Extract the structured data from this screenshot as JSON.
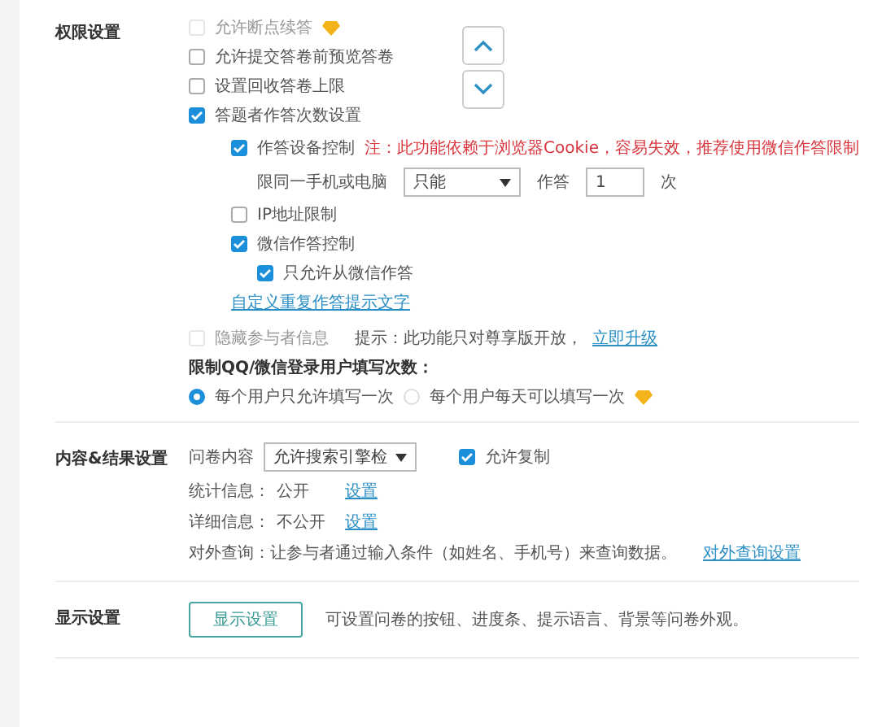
{
  "permission": {
    "title": "权限设置",
    "options": [
      {
        "label": "允许断点续答",
        "checked": false,
        "disabled": true,
        "premium": true
      },
      {
        "label": "允许提交答卷前预览答卷",
        "checked": false,
        "disabled": false,
        "premium": false
      },
      {
        "label": "设置回收答卷上限",
        "checked": false,
        "disabled": false,
        "premium": false
      },
      {
        "label": "答题者作答次数设置",
        "checked": true,
        "disabled": false,
        "premium": false
      }
    ],
    "device": {
      "label": "作答设备控制",
      "checked": true,
      "note": "注：此功能依赖于浏览器Cookie，容易失效，推荐使用微信作答限制",
      "prefix": "限同一手机或电脑",
      "select": "只能",
      "mid": "作答",
      "count": "1",
      "suffix": "次"
    },
    "ip": {
      "label": "IP地址限制",
      "checked": false
    },
    "wechat": {
      "label": "微信作答控制",
      "checked": true
    },
    "wechat_only": {
      "label": "只允许从微信作答",
      "checked": true
    },
    "custom_link": "自定义重复作答提示文字",
    "hide": {
      "label": "隐藏参与者信息",
      "checked": false,
      "disabled": true,
      "tip": "提示：此功能只对尊享版开放，",
      "link": "立即升级"
    },
    "limit_title": "限制QQ/微信登录用户填写次数：",
    "radios": [
      {
        "label": "每个用户只允许填写一次",
        "selected": true,
        "premium": false
      },
      {
        "label": "每个用户每天可以填写一次",
        "selected": false,
        "premium": true
      }
    ]
  },
  "content": {
    "title": "内容&结果设置",
    "survey_label": "问卷内容",
    "survey_select": "允许搜索引擎检",
    "copy": {
      "label": "允许复制",
      "checked": true
    },
    "rows": [
      {
        "label": "统计信息：",
        "value": "公开",
        "link": "设置"
      },
      {
        "label": "详细信息：",
        "value": "不公开",
        "link": "设置"
      }
    ],
    "query": {
      "text": "对外查询：让参与者通过输入条件（如姓名、手机号）来查询数据。",
      "link": "对外查询设置"
    }
  },
  "display": {
    "title": "显示设置",
    "button": "显示设置",
    "text": "可设置问卷的按钮、进度条、提示语言、背景等问卷外观。"
  }
}
